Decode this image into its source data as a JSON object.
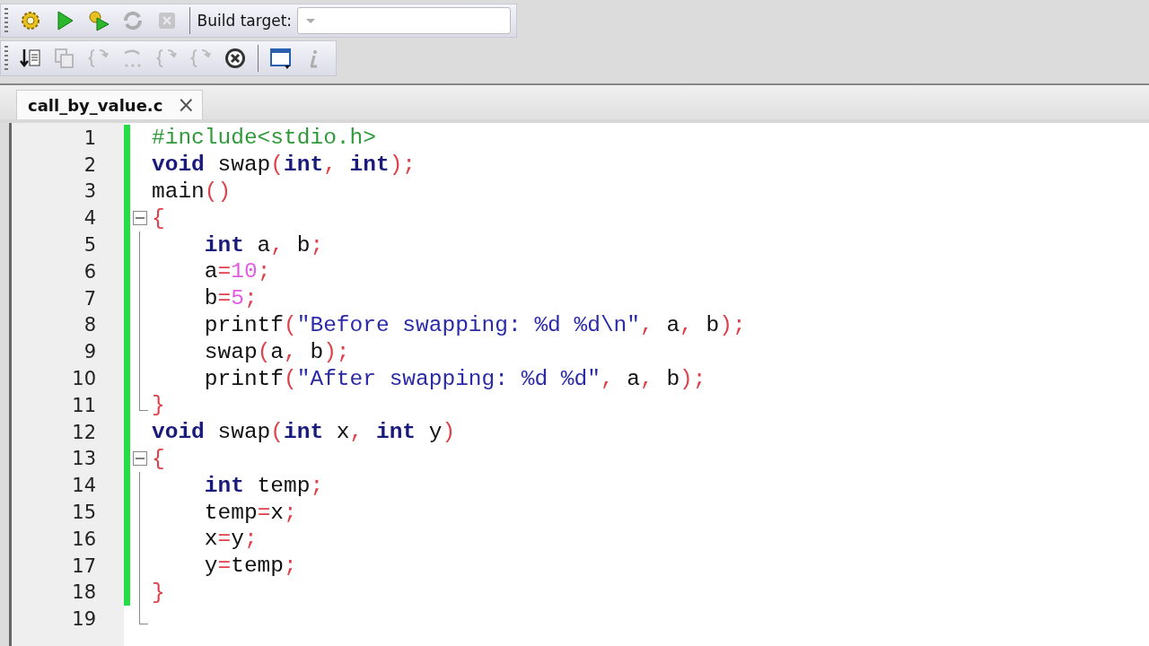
{
  "toolbars": [
    {
      "buttons": [
        {
          "kind": "gear",
          "disabled": false
        },
        {
          "kind": "run",
          "disabled": false
        },
        {
          "kind": "build-run",
          "disabled": false
        },
        {
          "kind": "rebuild",
          "disabled": true
        },
        {
          "kind": "abort",
          "disabled": true
        }
      ],
      "build_target": {
        "label": "Build target:"
      }
    },
    {
      "buttons": [
        {
          "kind": "down-doc",
          "disabled": false
        },
        {
          "kind": "copy-doc",
          "disabled": true
        },
        {
          "kind": "brace-a",
          "disabled": true
        },
        {
          "kind": "dots",
          "disabled": true
        },
        {
          "kind": "brace-b",
          "disabled": true
        },
        {
          "kind": "brace-c",
          "disabled": true
        },
        {
          "kind": "stop",
          "disabled": false
        },
        {
          "kind": "window",
          "disabled": false
        },
        {
          "kind": "info",
          "disabled": true
        }
      ]
    }
  ],
  "tabs": [
    {
      "label": "call_by_value.c",
      "close": "×",
      "selected": true
    }
  ],
  "editor": {
    "lines": [
      {
        "number": "1",
        "changed": true,
        "tokens": [
          {
            "kind": "pp",
            "t": "#include<stdio.h>"
          }
        ]
      },
      {
        "number": "2",
        "changed": true,
        "tokens": [
          {
            "kind": "kw",
            "t": "void"
          },
          {
            "kind": "id",
            "t": " swap"
          },
          {
            "kind": "op",
            "t": "("
          },
          {
            "kind": "kw",
            "t": "int"
          },
          {
            "kind": "op",
            "t": ","
          },
          {
            "kind": "kw",
            "t": " int"
          },
          {
            "kind": "op",
            "t": ");"
          }
        ]
      },
      {
        "number": "3",
        "changed": true,
        "tokens": [
          {
            "kind": "id",
            "t": "main"
          },
          {
            "kind": "op",
            "t": "()"
          }
        ]
      },
      {
        "number": "4",
        "changed": true,
        "fold": {
          "kind": "start"
        },
        "tokens": [
          {
            "kind": "op",
            "t": "{"
          }
        ]
      },
      {
        "number": "5",
        "changed": true,
        "fold": {
          "kind": "mid"
        },
        "tokens": [
          {
            "kind": "kw",
            "t": "    int"
          },
          {
            "kind": "id",
            "t": " a"
          },
          {
            "kind": "op",
            "t": ","
          },
          {
            "kind": "id",
            "t": " b"
          },
          {
            "kind": "op",
            "t": ";"
          }
        ]
      },
      {
        "number": "6",
        "changed": true,
        "fold": {
          "kind": "mid"
        },
        "tokens": [
          {
            "kind": "id",
            "t": "    a"
          },
          {
            "kind": "op",
            "t": "="
          },
          {
            "kind": "num",
            "t": "10"
          },
          {
            "kind": "op",
            "t": ";"
          }
        ]
      },
      {
        "number": "7",
        "changed": true,
        "fold": {
          "kind": "mid"
        },
        "tokens": [
          {
            "kind": "id",
            "t": "    b"
          },
          {
            "kind": "op",
            "t": "="
          },
          {
            "kind": "num",
            "t": "5"
          },
          {
            "kind": "op",
            "t": ";"
          }
        ]
      },
      {
        "number": "8",
        "changed": true,
        "fold": {
          "kind": "mid"
        },
        "tokens": [
          {
            "kind": "id",
            "t": "    printf"
          },
          {
            "kind": "op",
            "t": "("
          },
          {
            "kind": "str",
            "t": "\"Before swapping: %d %d\\n\""
          },
          {
            "kind": "op",
            "t": ","
          },
          {
            "kind": "id",
            "t": " a"
          },
          {
            "kind": "op",
            "t": ","
          },
          {
            "kind": "id",
            "t": " b"
          },
          {
            "kind": "op",
            "t": ");"
          }
        ]
      },
      {
        "number": "9",
        "changed": true,
        "fold": {
          "kind": "mid"
        },
        "tokens": [
          {
            "kind": "id",
            "t": "    swap"
          },
          {
            "kind": "op",
            "t": "("
          },
          {
            "kind": "id",
            "t": "a"
          },
          {
            "kind": "op",
            "t": ","
          },
          {
            "kind": "id",
            "t": " b"
          },
          {
            "kind": "op",
            "t": ");"
          }
        ]
      },
      {
        "number": "10",
        "changed": true,
        "fold": {
          "kind": "mid"
        },
        "tokens": [
          {
            "kind": "id",
            "t": "    printf"
          },
          {
            "kind": "op",
            "t": "("
          },
          {
            "kind": "str",
            "t": "\"After swapping: %d %d\""
          },
          {
            "kind": "op",
            "t": ","
          },
          {
            "kind": "id",
            "t": " a"
          },
          {
            "kind": "op",
            "t": ","
          },
          {
            "kind": "id",
            "t": " b"
          },
          {
            "kind": "op",
            "t": ");"
          }
        ]
      },
      {
        "number": "11",
        "changed": true,
        "fold": {
          "kind": "end"
        },
        "tokens": [
          {
            "kind": "op",
            "t": "}"
          }
        ]
      },
      {
        "number": "12",
        "changed": true,
        "tokens": [
          {
            "kind": "kw",
            "t": "void"
          },
          {
            "kind": "id",
            "t": " swap"
          },
          {
            "kind": "op",
            "t": "("
          },
          {
            "kind": "kw",
            "t": "int"
          },
          {
            "kind": "id",
            "t": " x"
          },
          {
            "kind": "op",
            "t": ","
          },
          {
            "kind": "kw",
            "t": " int"
          },
          {
            "kind": "id",
            "t": " y"
          },
          {
            "kind": "op",
            "t": ")"
          }
        ]
      },
      {
        "number": "13",
        "changed": true,
        "fold": {
          "kind": "start"
        },
        "tokens": [
          {
            "kind": "op",
            "t": "{"
          }
        ]
      },
      {
        "number": "14",
        "changed": true,
        "fold": {
          "kind": "mid"
        },
        "tokens": [
          {
            "kind": "kw",
            "t": "    int"
          },
          {
            "kind": "id",
            "t": " temp"
          },
          {
            "kind": "op",
            "t": ";"
          }
        ]
      },
      {
        "number": "15",
        "changed": true,
        "fold": {
          "kind": "mid"
        },
        "tokens": [
          {
            "kind": "id",
            "t": "    temp"
          },
          {
            "kind": "op",
            "t": "="
          },
          {
            "kind": "id",
            "t": "x"
          },
          {
            "kind": "op",
            "t": ";"
          }
        ]
      },
      {
        "number": "16",
        "changed": true,
        "fold": {
          "kind": "mid"
        },
        "tokens": [
          {
            "kind": "id",
            "t": "    x"
          },
          {
            "kind": "op",
            "t": "="
          },
          {
            "kind": "id",
            "t": "y"
          },
          {
            "kind": "op",
            "t": ";"
          }
        ]
      },
      {
        "number": "17",
        "changed": true,
        "fold": {
          "kind": "mid"
        },
        "tokens": [
          {
            "kind": "id",
            "t": "    y"
          },
          {
            "kind": "op",
            "t": "="
          },
          {
            "kind": "id",
            "t": "temp"
          },
          {
            "kind": "op",
            "t": ";"
          }
        ]
      },
      {
        "number": "18",
        "changed": true,
        "fold": {
          "kind": "mid"
        },
        "tokens": [
          {
            "kind": "op",
            "t": "}"
          }
        ]
      },
      {
        "number": "19",
        "changed": false,
        "fold": {
          "kind": "end"
        }
      }
    ]
  }
}
